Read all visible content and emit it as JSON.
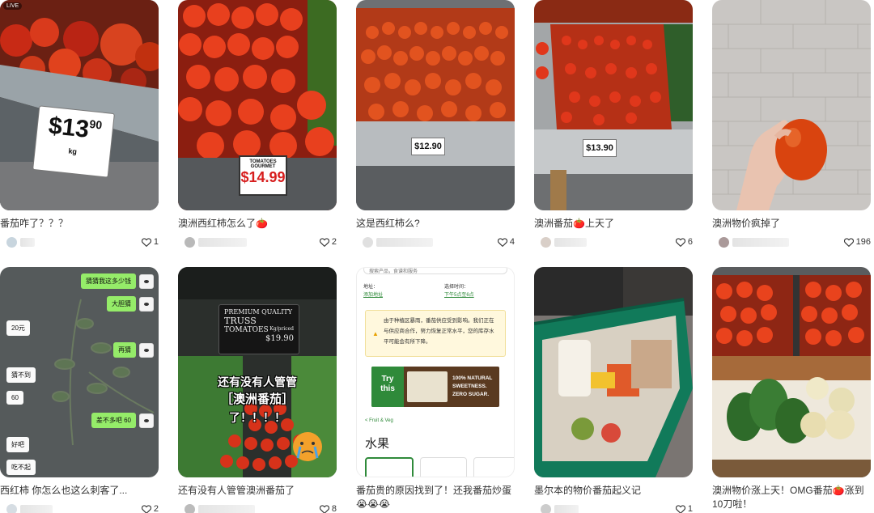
{
  "posts": [
    {
      "title": "番茄咋了？？？",
      "likes": "1",
      "tag": "LIVE",
      "price_big": "$13",
      "price_cents": "90",
      "price_unit": "kg"
    },
    {
      "title": "澳洲西红柿怎么了🍅",
      "likes": "2",
      "sign1": "TOMATOES",
      "sign2": "GOURMET",
      "price": "$14.99"
    },
    {
      "title": "这是西红柿么?",
      "likes": "4",
      "price": "$12.90"
    },
    {
      "title": "澳洲番茄🍅上天了",
      "likes": "6",
      "price": "$13.90"
    },
    {
      "title": "澳洲物价疯掉了",
      "likes": "196"
    },
    {
      "title": "西红柿 你怎么也这么刺客了...",
      "likes": "2",
      "chat": [
        "猜猜我这多少钱",
        "大胆猜",
        "20元",
        "再猜",
        "猜不到",
        "60",
        "差不多吧 60",
        "好吧",
        "吃不起"
      ]
    },
    {
      "title": "还有没有人管管澳洲番茄了",
      "likes": "8",
      "board1": "PREMIUM QUALITY",
      "board2": "TRUSS",
      "board3": "TOMATOES",
      "board4": "Kg/priced",
      "board5": "$19.90",
      "overlay1": "还有没有人管管",
      "overlay2": "［澳洲番茄］",
      "overlay3": "了！！！！"
    },
    {
      "title": "番茄贵的原因找到了！还我番茄炒蛋😭😭😭",
      "likes": "",
      "search": "搜索产品，食谱和服务",
      "pickup_label": "地址：",
      "pickup_link": "添加地址",
      "time_label": "选择时间：",
      "time_link": "下午5点至6点",
      "notice": "由于种植区暴雨，番茄供应受到影响。我们正在与供应商合作，努力恢复正常水平，您的库存水平可能会有所下降。",
      "ad1": "Try",
      "ad2": "this",
      "ad3": "100% NATURAL SWEETNESS. ZERO SUGAR.",
      "crumb": "< Fruit & Veg",
      "section": "水果"
    },
    {
      "title": "墨尔本的物价番茄起义记",
      "likes": "1"
    },
    {
      "title": "澳洲物价涨上天！OMG番茄🍅涨到10刀啦！",
      "likes": ""
    }
  ],
  "colors": {
    "accent_red": "#e33b20",
    "tomato": "#d9381c",
    "wechat_green": "#95ec69",
    "notice_bg": "#fff8dd",
    "ad_green": "#2f8a3a"
  }
}
